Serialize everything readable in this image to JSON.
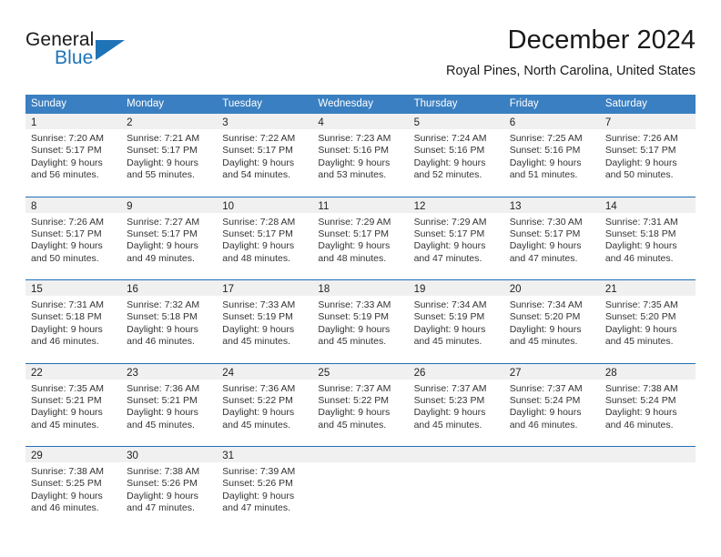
{
  "logo": {
    "word_top": "General",
    "word_bottom": "Blue",
    "icon": "triangle-flag-icon"
  },
  "header": {
    "month_title": "December 2024",
    "location": "Royal Pines, North Carolina, United States"
  },
  "colors": {
    "header_blue": "#3a7fc1",
    "row_divider_blue": "#1f6fb5",
    "day_band_gray": "#f0f0f0",
    "logo_blue": "#1f73b7",
    "text_dark": "#1a1a1a"
  },
  "weekdays": [
    "Sunday",
    "Monday",
    "Tuesday",
    "Wednesday",
    "Thursday",
    "Friday",
    "Saturday"
  ],
  "weeks": [
    [
      {
        "day": "1",
        "sunrise": "Sunrise: 7:20 AM",
        "sunset": "Sunset: 5:17 PM",
        "daylight_line1": "Daylight: 9 hours",
        "daylight_line2": "and 56 minutes."
      },
      {
        "day": "2",
        "sunrise": "Sunrise: 7:21 AM",
        "sunset": "Sunset: 5:17 PM",
        "daylight_line1": "Daylight: 9 hours",
        "daylight_line2": "and 55 minutes."
      },
      {
        "day": "3",
        "sunrise": "Sunrise: 7:22 AM",
        "sunset": "Sunset: 5:17 PM",
        "daylight_line1": "Daylight: 9 hours",
        "daylight_line2": "and 54 minutes."
      },
      {
        "day": "4",
        "sunrise": "Sunrise: 7:23 AM",
        "sunset": "Sunset: 5:16 PM",
        "daylight_line1": "Daylight: 9 hours",
        "daylight_line2": "and 53 minutes."
      },
      {
        "day": "5",
        "sunrise": "Sunrise: 7:24 AM",
        "sunset": "Sunset: 5:16 PM",
        "daylight_line1": "Daylight: 9 hours",
        "daylight_line2": "and 52 minutes."
      },
      {
        "day": "6",
        "sunrise": "Sunrise: 7:25 AM",
        "sunset": "Sunset: 5:16 PM",
        "daylight_line1": "Daylight: 9 hours",
        "daylight_line2": "and 51 minutes."
      },
      {
        "day": "7",
        "sunrise": "Sunrise: 7:26 AM",
        "sunset": "Sunset: 5:17 PM",
        "daylight_line1": "Daylight: 9 hours",
        "daylight_line2": "and 50 minutes."
      }
    ],
    [
      {
        "day": "8",
        "sunrise": "Sunrise: 7:26 AM",
        "sunset": "Sunset: 5:17 PM",
        "daylight_line1": "Daylight: 9 hours",
        "daylight_line2": "and 50 minutes."
      },
      {
        "day": "9",
        "sunrise": "Sunrise: 7:27 AM",
        "sunset": "Sunset: 5:17 PM",
        "daylight_line1": "Daylight: 9 hours",
        "daylight_line2": "and 49 minutes."
      },
      {
        "day": "10",
        "sunrise": "Sunrise: 7:28 AM",
        "sunset": "Sunset: 5:17 PM",
        "daylight_line1": "Daylight: 9 hours",
        "daylight_line2": "and 48 minutes."
      },
      {
        "day": "11",
        "sunrise": "Sunrise: 7:29 AM",
        "sunset": "Sunset: 5:17 PM",
        "daylight_line1": "Daylight: 9 hours",
        "daylight_line2": "and 48 minutes."
      },
      {
        "day": "12",
        "sunrise": "Sunrise: 7:29 AM",
        "sunset": "Sunset: 5:17 PM",
        "daylight_line1": "Daylight: 9 hours",
        "daylight_line2": "and 47 minutes."
      },
      {
        "day": "13",
        "sunrise": "Sunrise: 7:30 AM",
        "sunset": "Sunset: 5:17 PM",
        "daylight_line1": "Daylight: 9 hours",
        "daylight_line2": "and 47 minutes."
      },
      {
        "day": "14",
        "sunrise": "Sunrise: 7:31 AM",
        "sunset": "Sunset: 5:18 PM",
        "daylight_line1": "Daylight: 9 hours",
        "daylight_line2": "and 46 minutes."
      }
    ],
    [
      {
        "day": "15",
        "sunrise": "Sunrise: 7:31 AM",
        "sunset": "Sunset: 5:18 PM",
        "daylight_line1": "Daylight: 9 hours",
        "daylight_line2": "and 46 minutes."
      },
      {
        "day": "16",
        "sunrise": "Sunrise: 7:32 AM",
        "sunset": "Sunset: 5:18 PM",
        "daylight_line1": "Daylight: 9 hours",
        "daylight_line2": "and 46 minutes."
      },
      {
        "day": "17",
        "sunrise": "Sunrise: 7:33 AM",
        "sunset": "Sunset: 5:19 PM",
        "daylight_line1": "Daylight: 9 hours",
        "daylight_line2": "and 45 minutes."
      },
      {
        "day": "18",
        "sunrise": "Sunrise: 7:33 AM",
        "sunset": "Sunset: 5:19 PM",
        "daylight_line1": "Daylight: 9 hours",
        "daylight_line2": "and 45 minutes."
      },
      {
        "day": "19",
        "sunrise": "Sunrise: 7:34 AM",
        "sunset": "Sunset: 5:19 PM",
        "daylight_line1": "Daylight: 9 hours",
        "daylight_line2": "and 45 minutes."
      },
      {
        "day": "20",
        "sunrise": "Sunrise: 7:34 AM",
        "sunset": "Sunset: 5:20 PM",
        "daylight_line1": "Daylight: 9 hours",
        "daylight_line2": "and 45 minutes."
      },
      {
        "day": "21",
        "sunrise": "Sunrise: 7:35 AM",
        "sunset": "Sunset: 5:20 PM",
        "daylight_line1": "Daylight: 9 hours",
        "daylight_line2": "and 45 minutes."
      }
    ],
    [
      {
        "day": "22",
        "sunrise": "Sunrise: 7:35 AM",
        "sunset": "Sunset: 5:21 PM",
        "daylight_line1": "Daylight: 9 hours",
        "daylight_line2": "and 45 minutes."
      },
      {
        "day": "23",
        "sunrise": "Sunrise: 7:36 AM",
        "sunset": "Sunset: 5:21 PM",
        "daylight_line1": "Daylight: 9 hours",
        "daylight_line2": "and 45 minutes."
      },
      {
        "day": "24",
        "sunrise": "Sunrise: 7:36 AM",
        "sunset": "Sunset: 5:22 PM",
        "daylight_line1": "Daylight: 9 hours",
        "daylight_line2": "and 45 minutes."
      },
      {
        "day": "25",
        "sunrise": "Sunrise: 7:37 AM",
        "sunset": "Sunset: 5:22 PM",
        "daylight_line1": "Daylight: 9 hours",
        "daylight_line2": "and 45 minutes."
      },
      {
        "day": "26",
        "sunrise": "Sunrise: 7:37 AM",
        "sunset": "Sunset: 5:23 PM",
        "daylight_line1": "Daylight: 9 hours",
        "daylight_line2": "and 45 minutes."
      },
      {
        "day": "27",
        "sunrise": "Sunrise: 7:37 AM",
        "sunset": "Sunset: 5:24 PM",
        "daylight_line1": "Daylight: 9 hours",
        "daylight_line2": "and 46 minutes."
      },
      {
        "day": "28",
        "sunrise": "Sunrise: 7:38 AM",
        "sunset": "Sunset: 5:24 PM",
        "daylight_line1": "Daylight: 9 hours",
        "daylight_line2": "and 46 minutes."
      }
    ],
    [
      {
        "day": "29",
        "sunrise": "Sunrise: 7:38 AM",
        "sunset": "Sunset: 5:25 PM",
        "daylight_line1": "Daylight: 9 hours",
        "daylight_line2": "and 46 minutes."
      },
      {
        "day": "30",
        "sunrise": "Sunrise: 7:38 AM",
        "sunset": "Sunset: 5:26 PM",
        "daylight_line1": "Daylight: 9 hours",
        "daylight_line2": "and 47 minutes."
      },
      {
        "day": "31",
        "sunrise": "Sunrise: 7:39 AM",
        "sunset": "Sunset: 5:26 PM",
        "daylight_line1": "Daylight: 9 hours",
        "daylight_line2": "and 47 minutes."
      },
      {
        "day": "",
        "sunrise": "",
        "sunset": "",
        "daylight_line1": "",
        "daylight_line2": ""
      },
      {
        "day": "",
        "sunrise": "",
        "sunset": "",
        "daylight_line1": "",
        "daylight_line2": ""
      },
      {
        "day": "",
        "sunrise": "",
        "sunset": "",
        "daylight_line1": "",
        "daylight_line2": ""
      },
      {
        "day": "",
        "sunrise": "",
        "sunset": "",
        "daylight_line1": "",
        "daylight_line2": ""
      }
    ]
  ]
}
